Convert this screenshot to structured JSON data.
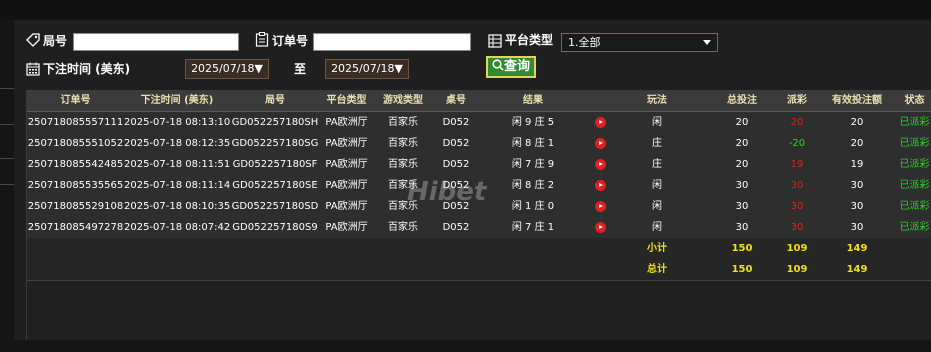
{
  "filters": {
    "round_label": "局号",
    "round_value": "",
    "order_label": "订单号",
    "order_value": "",
    "platform_label": "平台类型",
    "platform_value": "1.全部",
    "time_label": "下注时间 (美东)",
    "date_from": "2025/07/18▼",
    "to_label": "至",
    "date_to": "2025/07/18▼",
    "query_label": "查询"
  },
  "table": {
    "headers": [
      "订单号",
      "下注时间 (美东)",
      "局号",
      "平台类型",
      "游戏类型",
      "桌号",
      "结果",
      "玩法",
      "总投注",
      "派彩",
      "有效投注额",
      "状态"
    ],
    "rows": [
      {
        "order": "250718085557111",
        "time": "2025-07-18 08:13:10",
        "round": "GD052257180SH",
        "platform": "PA欧洲厅",
        "game": "百家乐",
        "table": "D052",
        "result": "闲 9 庄 5",
        "play": "闲",
        "bet": "20",
        "payout": "20",
        "payout_color": "#e02020",
        "valid": "20",
        "status": "已派彩"
      },
      {
        "order": "250718085551052",
        "time": "2025-07-18 08:12:35",
        "round": "GD052257180SG",
        "platform": "PA欧洲厅",
        "game": "百家乐",
        "table": "D052",
        "result": "闲 8 庄 1",
        "play": "庄",
        "bet": "20",
        "payout": "-20",
        "payout_color": "#30d030",
        "valid": "20",
        "status": "已派彩"
      },
      {
        "order": "250718085542485",
        "time": "2025-07-18 08:11:51",
        "round": "GD052257180SF",
        "platform": "PA欧洲厅",
        "game": "百家乐",
        "table": "D052",
        "result": "闲 7 庄 9",
        "play": "庄",
        "bet": "20",
        "payout": "19",
        "payout_color": "#e02020",
        "valid": "19",
        "status": "已派彩"
      },
      {
        "order": "250718085535565",
        "time": "2025-07-18 08:11:14",
        "round": "GD052257180SE",
        "platform": "PA欧洲厅",
        "game": "百家乐",
        "table": "D052",
        "result": "闲 8 庄 2",
        "play": "闲",
        "bet": "30",
        "payout": "30",
        "payout_color": "#e02020",
        "valid": "30",
        "status": "已派彩"
      },
      {
        "order": "250718085529108",
        "time": "2025-07-18 08:10:35",
        "round": "GD052257180SD",
        "platform": "PA欧洲厅",
        "game": "百家乐",
        "table": "D052",
        "result": "闲 1 庄 0",
        "play": "闲",
        "bet": "30",
        "payout": "30",
        "payout_color": "#e02020",
        "valid": "30",
        "status": "已派彩"
      },
      {
        "order": "250718085497278",
        "time": "2025-07-18 08:07:42",
        "round": "GD052257180S9",
        "platform": "PA欧洲厅",
        "game": "百家乐",
        "table": "D052",
        "result": "闲 7 庄 1",
        "play": "闲",
        "bet": "30",
        "payout": "30",
        "payout_color": "#e02020",
        "valid": "30",
        "status": "已派彩"
      }
    ],
    "subtotal": {
      "label": "小计",
      "bet": "150",
      "payout": "109",
      "valid": "149"
    },
    "total": {
      "label": "总计",
      "bet": "150",
      "payout": "109",
      "valid": "149"
    }
  },
  "watermark": "Hibet",
  "colors": {
    "status": "#30d030",
    "sum": "#f0e020",
    "header_text": "#e8e0b0"
  }
}
